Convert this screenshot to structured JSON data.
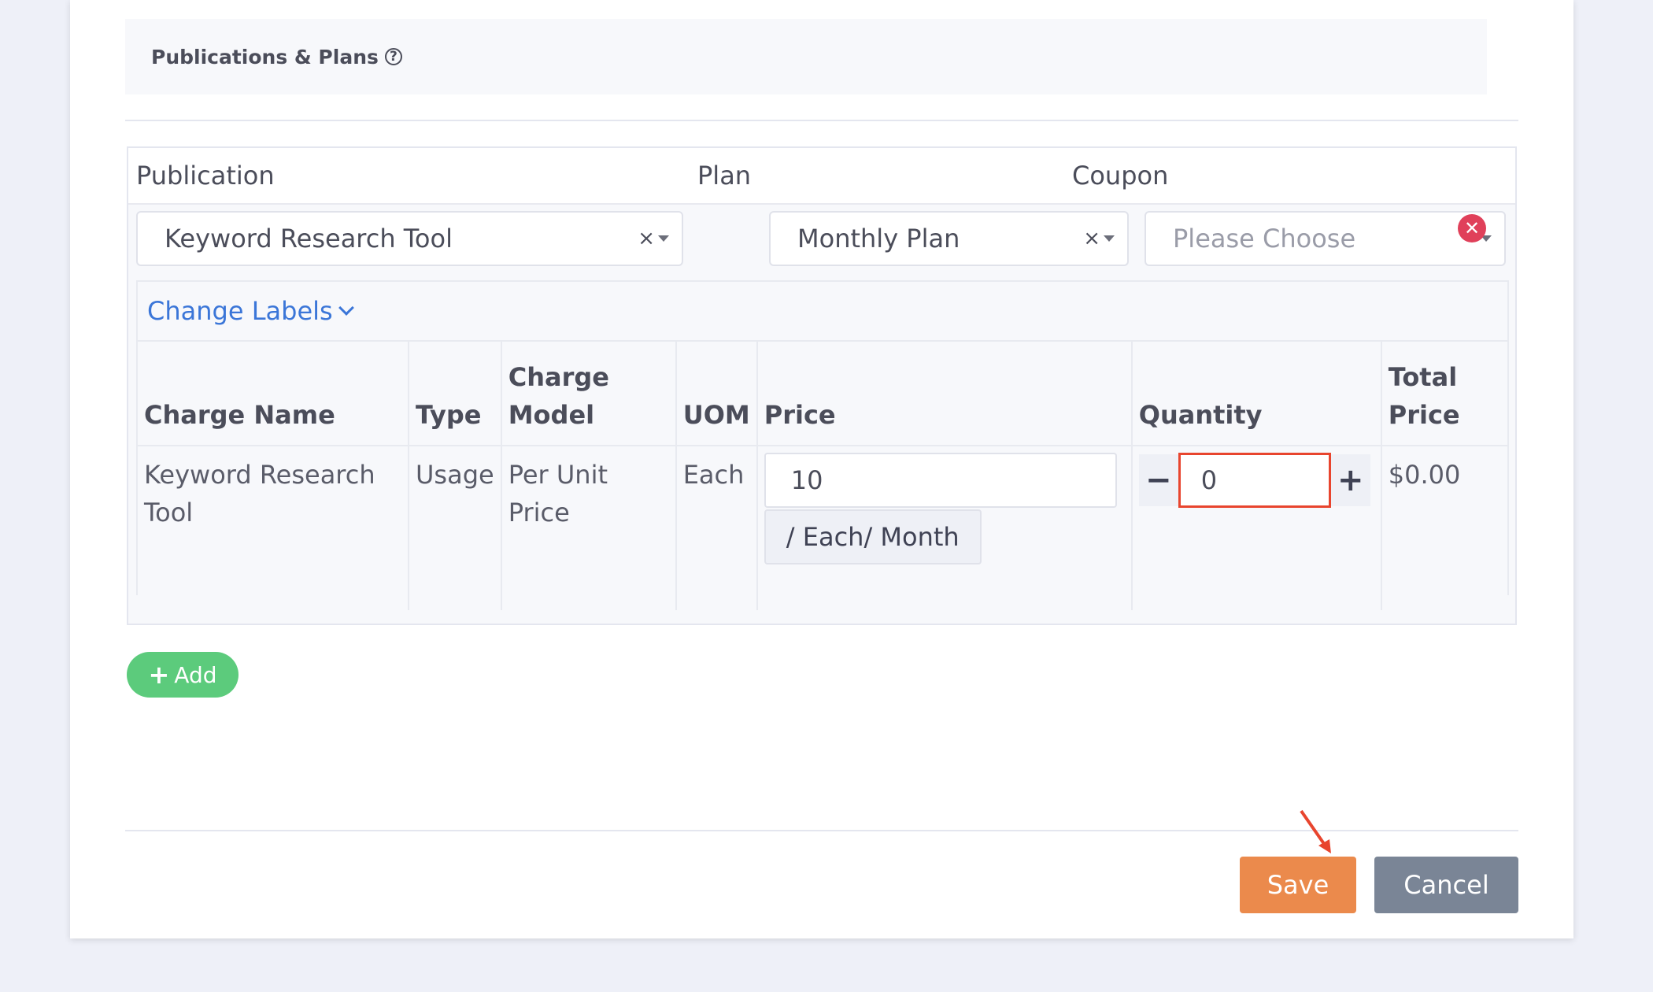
{
  "section": {
    "title": "Publications & Plans",
    "help_icon": "question-circle-icon"
  },
  "columns": {
    "publication": "Publication",
    "plan": "Plan",
    "coupon": "Coupon"
  },
  "selects": {
    "publication": {
      "value": "Keyword Research Tool",
      "clear": "×"
    },
    "plan": {
      "value": "Monthly Plan",
      "clear": "×"
    },
    "coupon": {
      "placeholder": "Please Choose"
    }
  },
  "change_labels": "Change Labels",
  "charges_table": {
    "headers": {
      "charge_name": "Charge Name",
      "type": "Type",
      "charge_model": "Charge Model",
      "uom": "UOM",
      "price": "Price",
      "quantity": "Quantity",
      "total_price": "Total Price"
    },
    "row": {
      "charge_name": "Keyword Research Tool",
      "type": "Usage",
      "charge_model": "Per Unit Price",
      "uom": "Each",
      "price": "10",
      "price_suffix": "/ Each/ Month",
      "quantity": "0",
      "total_price": "$0.00"
    }
  },
  "quantity_controls": {
    "minus": "−",
    "plus": "+"
  },
  "add_button": {
    "icon": "+",
    "label": "Add"
  },
  "footer": {
    "save": "Save",
    "cancel": "Cancel"
  },
  "colors": {
    "save": "#eb8a4c",
    "cancel": "#7a8596",
    "add": "#5ccb7c",
    "link": "#3b76d8",
    "remove": "#e0405a",
    "highlight": "#e8452e"
  }
}
